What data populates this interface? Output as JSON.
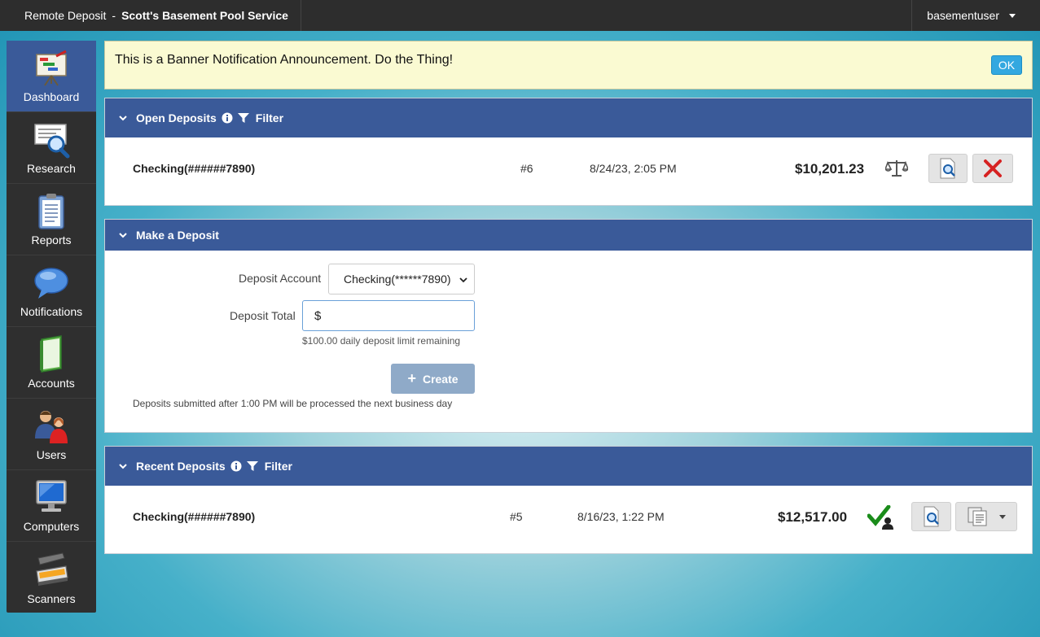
{
  "topbar": {
    "app": "Remote Deposit",
    "separator": "-",
    "org": "Scott's Basement Pool Service",
    "user": "basementuser"
  },
  "sidebar": {
    "items": [
      {
        "label": "Dashboard"
      },
      {
        "label": "Research"
      },
      {
        "label": "Reports"
      },
      {
        "label": "Notifications"
      },
      {
        "label": "Accounts"
      },
      {
        "label": "Users"
      },
      {
        "label": "Computers"
      },
      {
        "label": "Scanners"
      }
    ]
  },
  "banner": {
    "text": "This is a Banner Notification Announcement. Do the Thing!",
    "ok": "OK"
  },
  "open_deposits": {
    "title": "Open Deposits",
    "filter": "Filter",
    "rows": [
      {
        "account": "Checking(######7890)",
        "number": "#6",
        "date": "8/24/23, 2:05 PM",
        "amount": "$10,201.23"
      }
    ]
  },
  "make_deposit": {
    "title": "Make a Deposit",
    "account_label": "Deposit Account",
    "account_value": "Checking(******7890)",
    "total_label": "Deposit Total",
    "currency": "$",
    "limit": "$100.00 daily deposit limit remaining",
    "create": "Create",
    "note": "Deposits submitted after 1:00 PM will be processed the next business day"
  },
  "recent_deposits": {
    "title": "Recent Deposits",
    "filter": "Filter",
    "rows": [
      {
        "account": "Checking(######7890)",
        "number": "#5",
        "date": "8/16/23, 1:22 PM",
        "amount": "$12,517.00"
      }
    ]
  },
  "colors": {
    "header_blue": "#3a5a99",
    "banner_bg": "#fafad2",
    "ok_blue": "#33a8e0",
    "create_btn": "#8faac8",
    "delete_red": "#d62222",
    "approved_green": "#1a8c1a"
  }
}
